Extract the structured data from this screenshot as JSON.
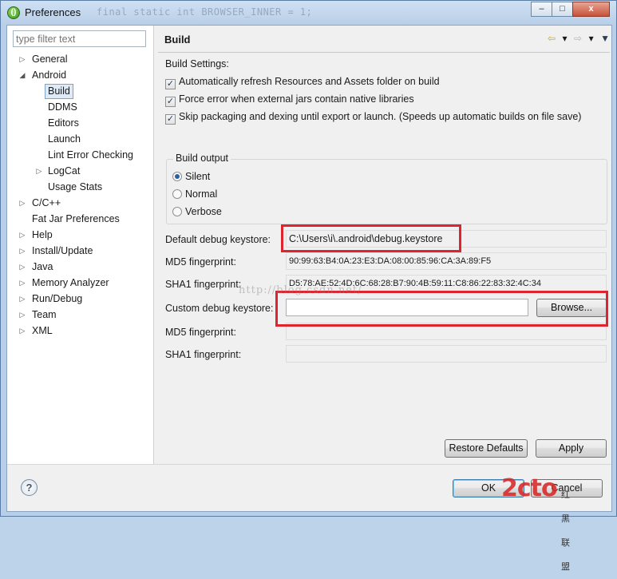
{
  "window": {
    "title": "Preferences",
    "background_code": "final static int BROWSER_INNER = 1;",
    "controls": {
      "minimize": "–",
      "maximize": "□",
      "close": "x"
    }
  },
  "sidebar": {
    "filter_placeholder": "type filter text",
    "tree": [
      {
        "label": "General",
        "expander": "▷"
      },
      {
        "label": "Android",
        "expander": "◢"
      },
      {
        "label": "Build",
        "selected": true
      },
      {
        "label": "DDMS"
      },
      {
        "label": "Editors"
      },
      {
        "label": "Launch"
      },
      {
        "label": "Lint Error Checking"
      },
      {
        "label": "LogCat",
        "expander": "▷"
      },
      {
        "label": "Usage Stats"
      },
      {
        "label": "C/C++",
        "expander": "▷"
      },
      {
        "label": "Fat Jar Preferences"
      },
      {
        "label": "Help",
        "expander": "▷"
      },
      {
        "label": "Install/Update",
        "expander": "▷"
      },
      {
        "label": "Java",
        "expander": "▷"
      },
      {
        "label": "Memory Analyzer",
        "expander": "▷"
      },
      {
        "label": "Run/Debug",
        "expander": "▷"
      },
      {
        "label": "Team",
        "expander": "▷"
      },
      {
        "label": "XML",
        "expander": "▷"
      }
    ]
  },
  "page": {
    "title": "Build",
    "nav": {
      "back": "⇦",
      "dropdown1": "▾",
      "forward": "⇨",
      "dropdown2": "▾",
      "menu": "▼"
    },
    "build_settings_label": "Build Settings:",
    "checkboxes": [
      {
        "label": "Automatically refresh Resources and Assets folder on build",
        "checked": true
      },
      {
        "label": "Force error when external jars contain native libraries",
        "checked": true
      },
      {
        "label": "Skip packaging and dexing until export or launch. (Speeds up automatic builds on file save)",
        "checked": true
      }
    ],
    "build_output": {
      "title": "Build output",
      "options": [
        {
          "label": "Silent",
          "selected": true
        },
        {
          "label": "Normal",
          "selected": false
        },
        {
          "label": "Verbose",
          "selected": false
        }
      ]
    },
    "default_keystore": {
      "label": "Default debug keystore:",
      "value": "C:\\Users\\i\\.android\\debug.keystore"
    },
    "default_md5": {
      "label": "MD5 fingerprint:",
      "value": "90:99:63:B4:0A:23:E3:DA:08:00:85:96:CA:3A:89:F5"
    },
    "default_sha1": {
      "label": "SHA1 fingerprint:",
      "value": "D5:78:AE:52:4D:6C:68:28:B7:90:4B:59:11:C8:86:22:83:32:4C:34"
    },
    "custom_keystore": {
      "label": "Custom debug keystore:",
      "value": ""
    },
    "browse_button": "Browse...",
    "custom_md5": {
      "label": "MD5 fingerprint:",
      "value": ""
    },
    "custom_sha1": {
      "label": "SHA1 fingerprint:",
      "value": ""
    },
    "restore_defaults": "Restore Defaults",
    "apply": "Apply"
  },
  "footer": {
    "help": "?",
    "ok": "OK",
    "cancel": "Cancel"
  },
  "overlays": {
    "watermark": "http://blog.csdn.net/",
    "logo": "2cto",
    "logo_suffix": "红黑联盟",
    "highlight_color": "#e0242f"
  }
}
